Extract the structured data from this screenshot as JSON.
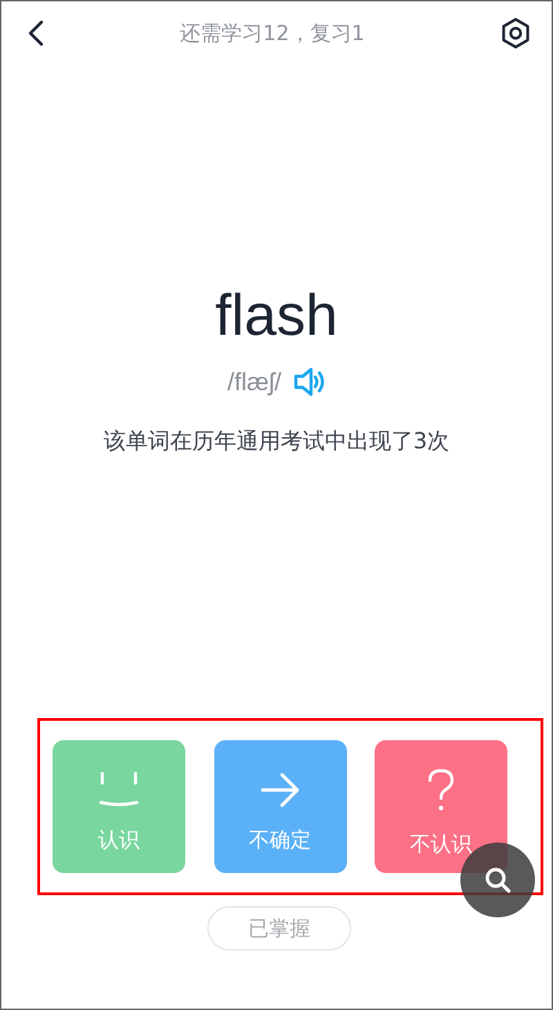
{
  "header": {
    "title": "还需学习12，复习1"
  },
  "word": {
    "text": "flash",
    "phonetic": "/flæʃ/",
    "note": "该单词在历年通用考试中出现了3次"
  },
  "answers": [
    {
      "kind": "smile",
      "label": "认识",
      "color": "#78d69e"
    },
    {
      "kind": "arrow",
      "label": "不确定",
      "color": "#5bb1f7"
    },
    {
      "kind": "question",
      "label": "不认识",
      "color": "#fc7186"
    }
  ],
  "mastered_button": "已掌握"
}
